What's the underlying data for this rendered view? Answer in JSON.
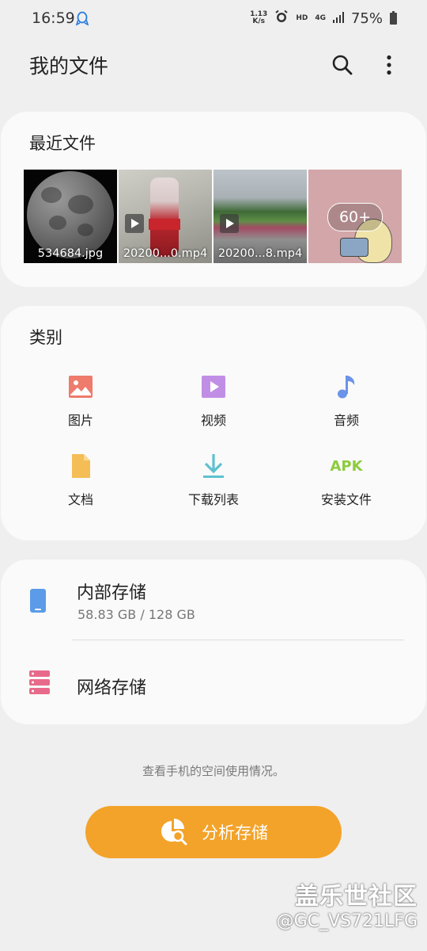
{
  "status_bar": {
    "time": "16:59",
    "net_speed_value": "1.13",
    "net_speed_unit": "K/s",
    "hd": "HD",
    "network": "4G",
    "battery": "75%"
  },
  "header": {
    "title": "我的文件"
  },
  "recent": {
    "title": "最近文件",
    "files": [
      {
        "name": "534684.jpg",
        "type": "image"
      },
      {
        "name": "20200...0.mp4",
        "type": "video"
      },
      {
        "name": "20200...8.mp4",
        "type": "video"
      }
    ],
    "more_count": "60+"
  },
  "categories": {
    "title": "类别",
    "items": [
      {
        "label": "图片",
        "icon": "image-icon",
        "color": "#ee7b6c"
      },
      {
        "label": "视频",
        "icon": "video-icon",
        "color": "#c18ee6"
      },
      {
        "label": "音频",
        "icon": "music-icon",
        "color": "#6b93e8"
      },
      {
        "label": "文档",
        "icon": "document-icon",
        "color": "#f5bd55"
      },
      {
        "label": "下载列表",
        "icon": "download-icon",
        "color": "#5ec1cf"
      },
      {
        "label": "安装文件",
        "icon": "apk-icon",
        "icon_text": "APK",
        "color": "#8ccc3d"
      }
    ]
  },
  "storage": {
    "internal": {
      "title": "内部存储",
      "usage": "58.83 GB / 128 GB",
      "color": "#5b9be8"
    },
    "network": {
      "title": "网络存储",
      "color": "#e86a8a"
    }
  },
  "usage_hint": "查看手机的空间使用情况。",
  "analyze_button": "分析存储",
  "watermark": {
    "line1": "盖乐世社区",
    "line2": "@GC_VS721LFG"
  }
}
